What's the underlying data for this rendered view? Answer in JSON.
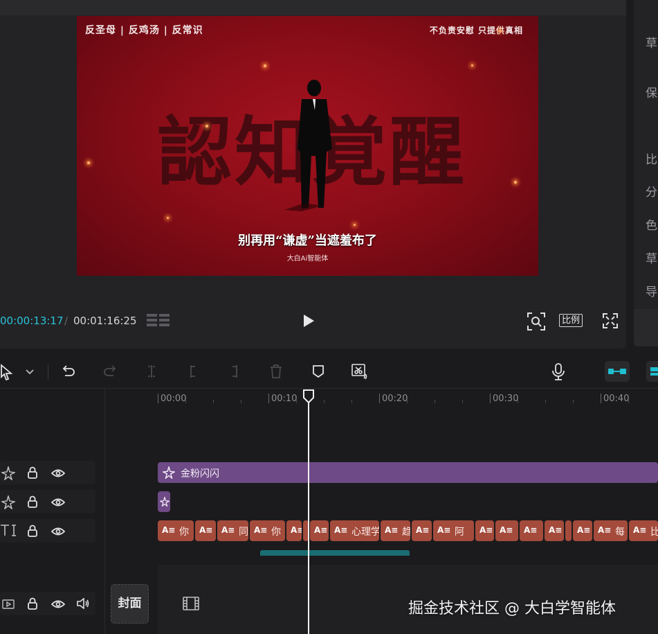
{
  "preview": {
    "video": {
      "top_left_text": "反圣母 | 反鸡汤 | 反常识",
      "top_right_text": "不负责安慰 只提供真相",
      "big_title": "認知覚醒",
      "subtitle": "别再用“谦虚”当遮羞布了",
      "credit": "大白Ai智能体"
    },
    "time_current": "00:00:13:17",
    "time_separator": "/",
    "time_total": "00:01:16:25",
    "ratio_label": "比例"
  },
  "props_panel": {
    "labels": [
      "草",
      "保",
      "比",
      "分",
      "色",
      "草",
      "导"
    ]
  },
  "toolbar": {
    "icons": [
      "select-cursor-icon",
      "chevron-down-icon",
      "undo-icon",
      "redo-icon",
      "split-icon",
      "split-left-icon",
      "split-right-icon",
      "delete-icon",
      "marker-icon",
      "auto-cut-icon",
      "microphone-icon",
      "link-tracks-icon",
      "snap-icon"
    ]
  },
  "timeline": {
    "ruler_labels": [
      "00:00",
      "00:10",
      "00:20",
      "00:30",
      "00:40"
    ],
    "effect_track_1_clip": "金粉闪闪",
    "text_clips": [
      "你",
      "",
      "同",
      "你",
      "",
      "",
      "心理学",
      "趋",
      "",
      "阿",
      "",
      "",
      "",
      "",
      "",
      "",
      "每",
      "比"
    ],
    "text_clip_prefix": "A≡",
    "cover_label": "封面"
  },
  "watermark": "掘金技术社区 @ 大白学智能体",
  "colors": {
    "accent_cyan": "#28c4d8",
    "effect_clip": "#6e4a86",
    "text_clip": "#a44b3c",
    "background": "#1b1b1d"
  }
}
